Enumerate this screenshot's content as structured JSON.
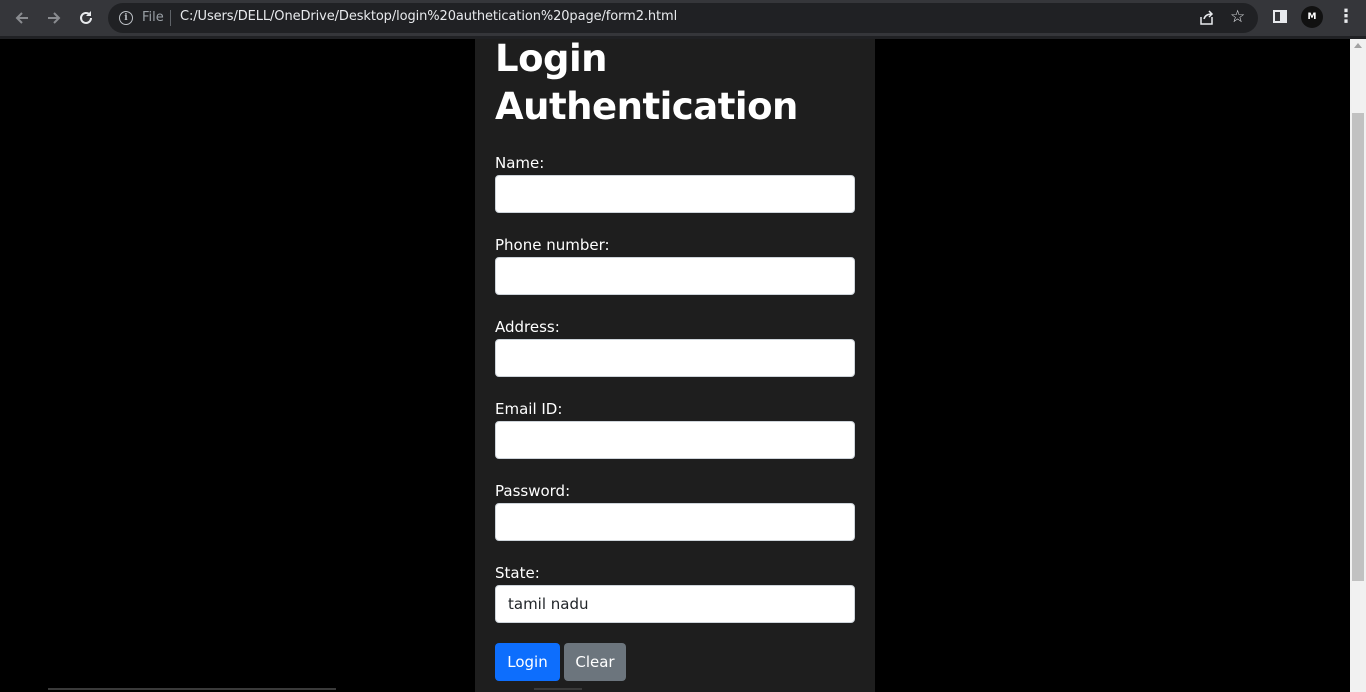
{
  "browser": {
    "scheme_label": "File",
    "url": "C:/Users/DELL/OneDrive/Desktop/login%20authetication%20page/form2.html",
    "profile_initials": "M"
  },
  "page": {
    "title_line1": "Login",
    "title_line2": "Authentication",
    "fields": [
      {
        "label": "Name:",
        "value": ""
      },
      {
        "label": "Phone number:",
        "value": ""
      },
      {
        "label": "Address:",
        "value": ""
      },
      {
        "label": "Email ID:",
        "value": ""
      },
      {
        "label": "Password:",
        "value": ""
      },
      {
        "label": "State:",
        "value": "tamil nadu"
      }
    ],
    "login_label": "Login",
    "clear_label": "Clear"
  },
  "colors": {
    "primary_button": "#0d6efd",
    "secondary_button": "#6c757d",
    "card_background": "#1e1e1e"
  }
}
